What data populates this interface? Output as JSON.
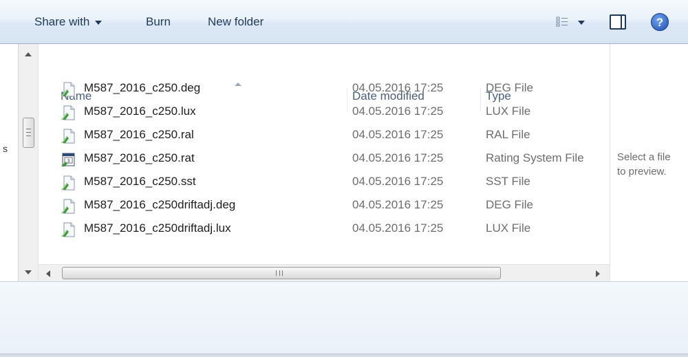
{
  "toolbar": {
    "share_with": "Share with",
    "burn": "Burn",
    "new_folder": "New folder",
    "help_glyph": "?"
  },
  "columns": {
    "name": "Name",
    "date_modified": "Date modified",
    "type": "Type"
  },
  "files": [
    {
      "name": "M587_2016_c250.deg",
      "date": "04.05.2016 17:25",
      "type": "DEG File",
      "icon": "generic-file-icon"
    },
    {
      "name": "M587_2016_c250.lux",
      "date": "04.05.2016 17:25",
      "type": "LUX File",
      "icon": "generic-file-icon"
    },
    {
      "name": "M587_2016_c250.ral",
      "date": "04.05.2016 17:25",
      "type": "RAL File",
      "icon": "generic-file-icon"
    },
    {
      "name": "M587_2016_c250.rat",
      "date": "04.05.2016 17:25",
      "type": "Rating System File",
      "icon": "rating-system-file-icon"
    },
    {
      "name": "M587_2016_c250.sst",
      "date": "04.05.2016 17:25",
      "type": "SST File",
      "icon": "generic-file-icon"
    },
    {
      "name": "M587_2016_c250driftadj.deg",
      "date": "04.05.2016 17:25",
      "type": "DEG File",
      "icon": "generic-file-icon"
    },
    {
      "name": "M587_2016_c250driftadj.lux",
      "date": "04.05.2016 17:25",
      "type": "LUX File",
      "icon": "generic-file-icon"
    }
  ],
  "preview": {
    "line1": "Select a file",
    "line2": "to preview."
  },
  "left_edge_text": "s",
  "colors": {
    "toolbar_text": "#1e395b",
    "secondary_text": "#6d6d6d"
  }
}
